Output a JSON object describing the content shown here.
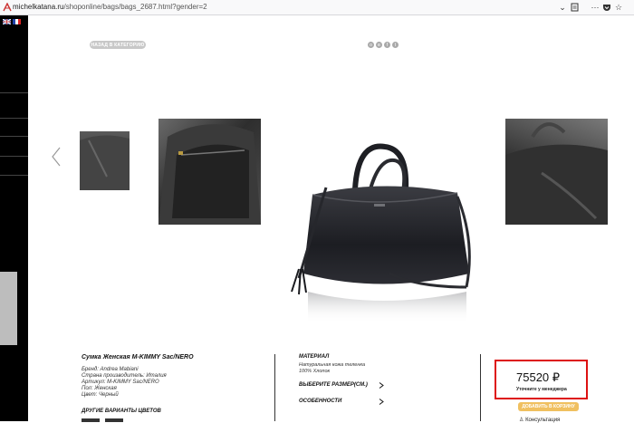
{
  "browser": {
    "url_host": "michelkatana.ru",
    "url_path": "/shoponline/bags/bags_2687.html?gender=2"
  },
  "page": {
    "back_label": "НАЗАД В КАТЕГОРИЮ",
    "product": {
      "title": "Сумка Женская M-KIMMY Sac/NERO",
      "specs": [
        "Бренд: Andrea Mabiani",
        "Страна производитель: Италия",
        "Артикул: M-KIMMY Sac/NERO",
        "Пол: Женская",
        "Цвет: Черный"
      ],
      "other_colors_label": "ДРУГИЕ ВАРИАНТЫ ЦВЕТОВ"
    },
    "material": {
      "title": "МАТЕРИАЛ",
      "lines": [
        "Натуральная кожа теленка",
        "100% Хлопок"
      ],
      "size_label": "ВЫБЕРИТЕ РАЗМЕР(СМ.)",
      "features_label": "ОСОБЕННОСТИ"
    },
    "price": {
      "value": "75520",
      "currency": "₽",
      "note": "Уточните у менеджера",
      "cart_label": "ДОБАВИТЬ В КОРЗИНУ",
      "consult_label": "Консультация"
    }
  }
}
